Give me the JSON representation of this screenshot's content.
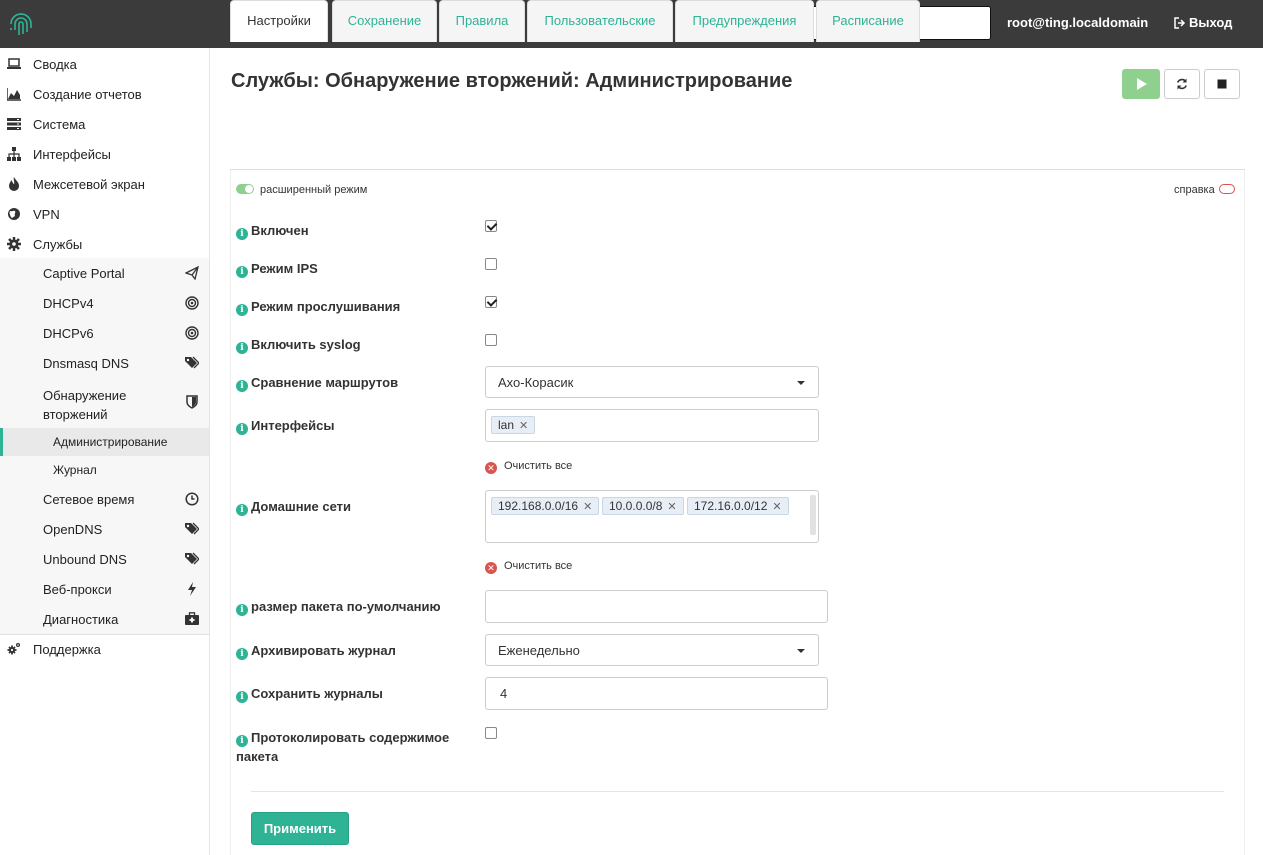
{
  "header": {
    "user": "root@ting.localdomain",
    "logout_label": "Выход",
    "search": {
      "value": "",
      "placeholder": ""
    }
  },
  "sidebar": {
    "items": [
      {
        "label": "Сводка",
        "icon": "laptop-icon"
      },
      {
        "label": "Создание отчетов",
        "icon": "area-chart-icon"
      },
      {
        "label": "Система",
        "icon": "server-icon"
      },
      {
        "label": "Интерфейсы",
        "icon": "sitemap-icon"
      },
      {
        "label": "Межсетевой экран",
        "icon": "fire-icon"
      },
      {
        "label": "VPN",
        "icon": "globe-icon"
      },
      {
        "label": "Службы",
        "icon": "cog-icon"
      }
    ],
    "services": [
      {
        "label": "Captive Portal",
        "icon": "paper-plane-icon"
      },
      {
        "label": "DHCPv4",
        "icon": "bullseye-icon"
      },
      {
        "label": "DHCPv6",
        "icon": "bullseye-icon"
      },
      {
        "label": "Dnsmasq DNS",
        "icon": "tags-icon"
      },
      {
        "label": "Обнаружение вторжений",
        "icon": "shield-icon"
      },
      {
        "label": "Сетевое время",
        "icon": "clock-icon"
      },
      {
        "label": "OpenDNS",
        "icon": "tags-icon"
      },
      {
        "label": "Unbound DNS",
        "icon": "tags-icon"
      },
      {
        "label": "Веб-прокси",
        "icon": "bolt-icon"
      },
      {
        "label": "Диагностика",
        "icon": "medkit-icon"
      }
    ],
    "ids_sub": [
      {
        "label": "Администрирование",
        "active": true
      },
      {
        "label": "Журнал",
        "active": false
      }
    ],
    "support_label": "Поддержка"
  },
  "main": {
    "title": "Службы: Обнаружение вторжений: Администрирование",
    "tabs": [
      {
        "label": "Настройки",
        "active": true
      },
      {
        "label": "Сохранение",
        "active": false
      },
      {
        "label": "Правила",
        "active": false
      },
      {
        "label": "Пользовательские",
        "active": false
      },
      {
        "label": "Предупреждения",
        "active": false
      },
      {
        "label": "Расписание",
        "active": false
      }
    ],
    "advanced_mode_label": "расширенный режим",
    "help_label": "справка",
    "form": {
      "enabled": {
        "label": "Включен",
        "checked": true
      },
      "ips_mode": {
        "label": "Режим IPS",
        "checked": false
      },
      "promisc": {
        "label": "Режим прослушивания",
        "checked": true
      },
      "syslog": {
        "label": "Включить syslog",
        "checked": false
      },
      "pattern_matcher": {
        "label": "Сравнение маршрутов",
        "value": "Ахо-Корасик"
      },
      "interfaces": {
        "label": "Интерфейсы",
        "tags": [
          "lan"
        ]
      },
      "home_nets": {
        "label": "Домашние сети",
        "tags": [
          "192.168.0.0/16",
          "10.0.0.0/8",
          "172.16.0.0/12"
        ]
      },
      "clear_all_label": "Очистить все",
      "snaplen": {
        "label": "размер пакета по-умолчанию",
        "value": ""
      },
      "log_rotate": {
        "label": "Архивировать журнал",
        "value": "Еженедельно"
      },
      "log_keep": {
        "label": "Сохранить журналы",
        "value": "4"
      },
      "log_payload": {
        "label": "Протоколировать содержимое пакета",
        "checked": false
      }
    },
    "apply_label": "Применить"
  },
  "colors": {
    "accent": "#2eb395",
    "topbar": "#3b3b3b",
    "play_button": "#8fd08e",
    "danger": "#d9534f"
  }
}
